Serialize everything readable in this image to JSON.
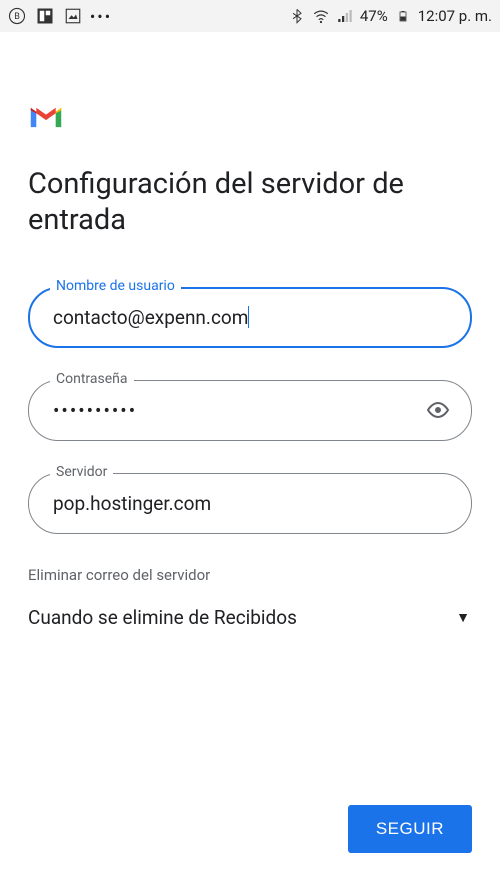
{
  "status_bar": {
    "battery_percent": "47%",
    "time": "12:07 p. m."
  },
  "page": {
    "title": "Configuración del servidor de entrada"
  },
  "fields": {
    "username": {
      "label": "Nombre de usuario",
      "value": "contacto@expenn.com"
    },
    "password": {
      "label": "Contraseña",
      "value": "••••••••••"
    },
    "server": {
      "label": "Servidor",
      "value": "pop.hostinger.com"
    }
  },
  "delete_section": {
    "label": "Eliminar correo del servidor",
    "selected": "Cuando se elimine de Recibidos"
  },
  "buttons": {
    "next": "SEGUIR"
  }
}
